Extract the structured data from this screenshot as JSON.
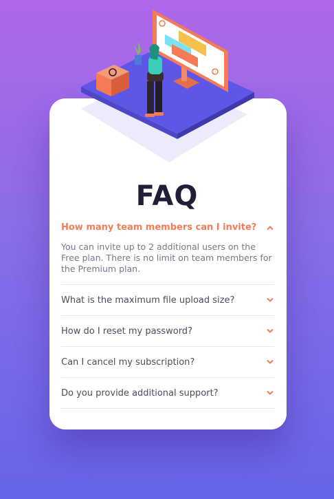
{
  "page": {
    "title": "FAQ"
  },
  "colors": {
    "accent": "#f47b56",
    "heading": "#1e1f36",
    "question": "#4b4c5f",
    "answer": "#787887",
    "gradient_top": "#af67e9",
    "gradient_bottom": "#6565e7"
  },
  "faq": {
    "items": [
      {
        "question": "How many team members can I invite?",
        "answer": "You can invite up to 2 additional users on the Free plan. There is no limit on team members for the Premium plan.",
        "open": true,
        "icon": "chevron-up-icon"
      },
      {
        "question": "What is the maximum file upload size?",
        "open": false,
        "icon": "chevron-down-icon"
      },
      {
        "question": "How do I reset my password?",
        "open": false,
        "icon": "chevron-down-icon"
      },
      {
        "question": "Can I cancel my subscription?",
        "open": false,
        "icon": "chevron-down-icon"
      },
      {
        "question": "Do you provide additional support?",
        "open": false,
        "icon": "chevron-down-icon"
      }
    ]
  },
  "illustration": {
    "icon": "woman-online-illustration"
  }
}
